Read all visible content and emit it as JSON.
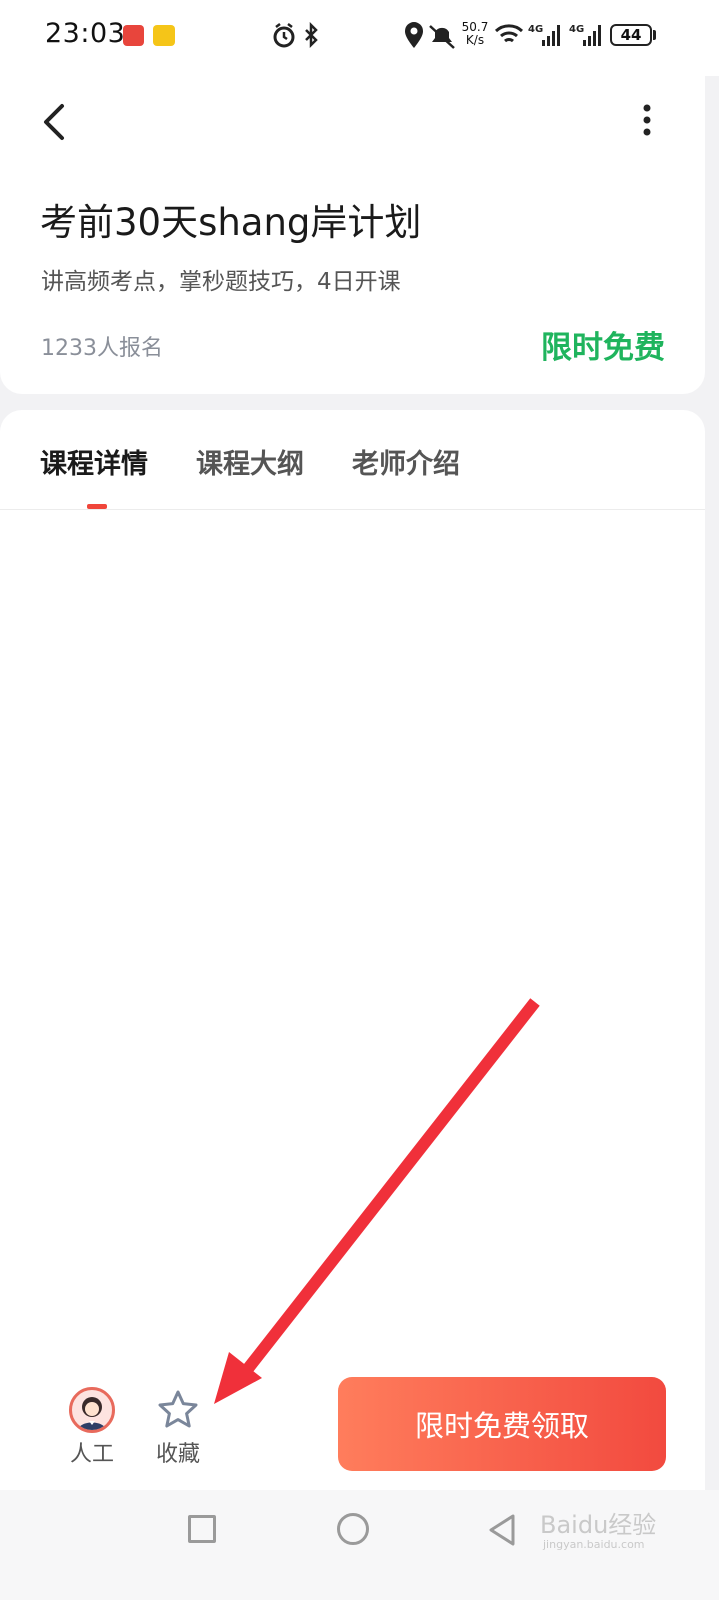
{
  "status_bar": {
    "time": "23:03",
    "net_speed_value": "50.7",
    "net_speed_unit": "K/s",
    "battery": "44",
    "icons": [
      "app-icon-red",
      "app-icon-yellow",
      "alarm-icon",
      "bluetooth-icon",
      "location-icon",
      "mute-icon",
      "wifi-icon",
      "signal-4g-icon",
      "signal-4g-icon"
    ]
  },
  "header": {
    "back_icon": "chevron-left-icon",
    "more_icon": "more-vertical-icon",
    "title": "考前30天shang岸计划",
    "subtitle": "讲高频考点，掌秒题技巧，4日开课",
    "enroll_count": "1233人报名",
    "price_tag": "限时免费",
    "price_color": "#1fb45d"
  },
  "tabs": [
    {
      "label": "课程详情",
      "active": true
    },
    {
      "label": "课程大纲",
      "active": false
    },
    {
      "label": "老师介绍",
      "active": false
    }
  ],
  "bottom_bar": {
    "agent_label": "人工",
    "favorite_label": "收藏",
    "claim_button": "限时免费领取",
    "accent_color": "#f24a3f"
  },
  "nav_bar": {
    "icons": [
      "recents-square-icon",
      "home-circle-icon",
      "back-triangle-icon"
    ]
  },
  "watermark": {
    "text": "Baidu经验",
    "sub": "jingyan.baidu.com"
  }
}
